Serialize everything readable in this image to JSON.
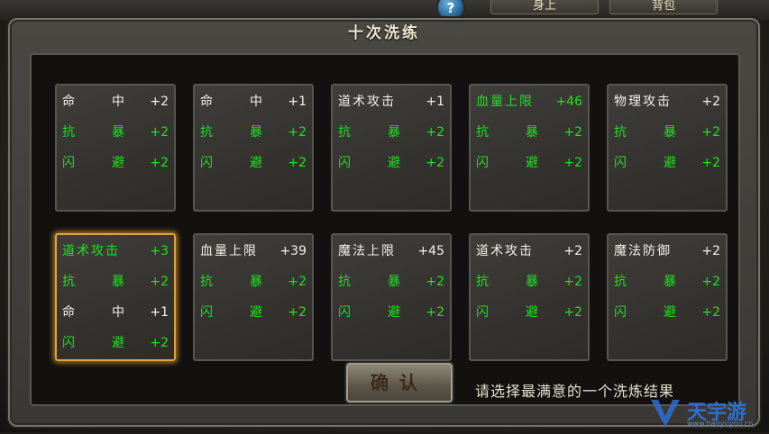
{
  "top_buttons": {
    "left": "身上",
    "right": "背包"
  },
  "help_icon_glyph": "?",
  "dialog": {
    "title": "十次洗练"
  },
  "cards": [
    {
      "rows": [
        {
          "a": "命",
          "b": "中",
          "v": "+2",
          "color": "white"
        },
        {
          "a": "抗",
          "b": "暴",
          "v": "+2",
          "color": "green"
        },
        {
          "a": "闪",
          "b": "避",
          "v": "+2",
          "color": "green"
        }
      ]
    },
    {
      "rows": [
        {
          "a": "命",
          "b": "中",
          "v": "+1",
          "color": "white"
        },
        {
          "a": "抗",
          "b": "暴",
          "v": "+2",
          "color": "green"
        },
        {
          "a": "闪",
          "b": "避",
          "v": "+2",
          "color": "green"
        }
      ]
    },
    {
      "rows": [
        {
          "full": "道术攻击",
          "v": "+1",
          "color": "white"
        },
        {
          "a": "抗",
          "b": "暴",
          "v": "+2",
          "color": "green"
        },
        {
          "a": "闪",
          "b": "避",
          "v": "+2",
          "color": "green"
        }
      ]
    },
    {
      "rows": [
        {
          "full": "血量上限",
          "v": "+46",
          "color": "green"
        },
        {
          "a": "抗",
          "b": "暴",
          "v": "+2",
          "color": "green"
        },
        {
          "a": "闪",
          "b": "避",
          "v": "+2",
          "color": "green"
        }
      ]
    },
    {
      "rows": [
        {
          "full": "物理攻击",
          "v": "+2",
          "color": "white"
        },
        {
          "a": "抗",
          "b": "暴",
          "v": "+2",
          "color": "green"
        },
        {
          "a": "闪",
          "b": "避",
          "v": "+2",
          "color": "green"
        }
      ]
    },
    {
      "selected": true,
      "rows": [
        {
          "full": "道术攻击",
          "v": "+3",
          "color": "green"
        },
        {
          "a": "抗",
          "b": "暴",
          "v": "+2",
          "color": "green"
        },
        {
          "a": "命",
          "b": "中",
          "v": "+1",
          "color": "white"
        },
        {
          "a": "闪",
          "b": "避",
          "v": "+2",
          "color": "green"
        }
      ]
    },
    {
      "rows": [
        {
          "full": "血量上限",
          "v": "+39",
          "color": "white"
        },
        {
          "a": "抗",
          "b": "暴",
          "v": "+2",
          "color": "green"
        },
        {
          "a": "闪",
          "b": "避",
          "v": "+2",
          "color": "green"
        }
      ]
    },
    {
      "rows": [
        {
          "full": "魔法上限",
          "v": "+45",
          "color": "white"
        },
        {
          "a": "抗",
          "b": "暴",
          "v": "+2",
          "color": "green"
        },
        {
          "a": "闪",
          "b": "避",
          "v": "+2",
          "color": "green"
        }
      ]
    },
    {
      "rows": [
        {
          "full": "道术攻击",
          "v": "+2",
          "color": "white"
        },
        {
          "a": "抗",
          "b": "暴",
          "v": "+2",
          "color": "green"
        },
        {
          "a": "闪",
          "b": "避",
          "v": "+2",
          "color": "green"
        }
      ]
    },
    {
      "rows": [
        {
          "full": "魔法防御",
          "v": "+2",
          "color": "white"
        },
        {
          "a": "抗",
          "b": "暴",
          "v": "+2",
          "color": "green"
        },
        {
          "a": "闪",
          "b": "避",
          "v": "+2",
          "color": "green"
        }
      ]
    }
  ],
  "confirm_button": "确认",
  "hint": "请选择最满意的一个洗炼结果",
  "watermark": {
    "main": "天宇游",
    "sub": "www.tianyuyou.cn"
  },
  "colors": {
    "white_text": "#f4f1ea",
    "green_text": "#20e020",
    "selected_border": "#e0a23a"
  }
}
